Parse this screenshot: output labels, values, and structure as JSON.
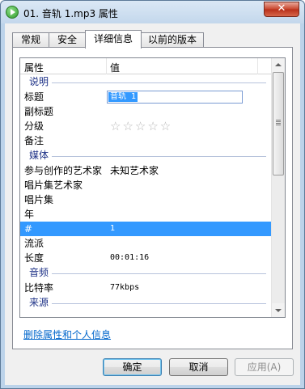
{
  "window": {
    "title": "01. 音轨 1.mp3 属性",
    "close_glyph": "✕"
  },
  "tabs": [
    {
      "label": "常规"
    },
    {
      "label": "安全"
    },
    {
      "label": "详细信息",
      "active": true
    },
    {
      "label": "以前的版本"
    }
  ],
  "list": {
    "header": {
      "name": "属性",
      "value": "值"
    },
    "groups": {
      "description": "说明",
      "media": "媒体",
      "audio": "音频",
      "origin": "来源"
    },
    "rows": {
      "title": {
        "name": "标题",
        "value": "音轨 1"
      },
      "subtitle": {
        "name": "副标题",
        "value": ""
      },
      "rating": {
        "name": "分级",
        "value": "☆☆☆☆☆",
        "stars": 0
      },
      "comment": {
        "name": "备注",
        "value": ""
      },
      "contributing_artist": {
        "name": "参与创作的艺术家",
        "value": "未知艺术家"
      },
      "album_artist": {
        "name": "唱片集艺术家",
        "value": ""
      },
      "album": {
        "name": "唱片集",
        "value": ""
      },
      "year": {
        "name": "年",
        "value": ""
      },
      "track_number": {
        "name": "#",
        "value": "1"
      },
      "genre": {
        "name": "流派",
        "value": ""
      },
      "length": {
        "name": "长度",
        "value": "00:01:16"
      },
      "bitrate": {
        "name": "比特率",
        "value": "77kbps"
      }
    }
  },
  "remove_link": "删除属性和个人信息",
  "buttons": {
    "ok": "确定",
    "cancel": "取消",
    "apply": "应用(A)"
  }
}
